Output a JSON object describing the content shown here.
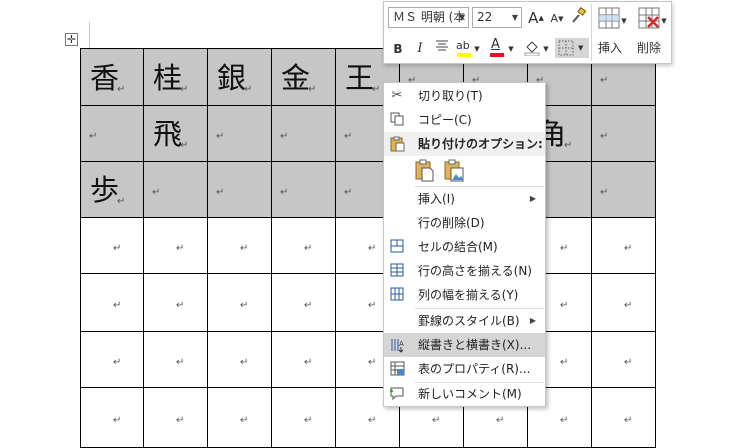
{
  "table": {
    "row_heights": [
      58,
      56,
      56,
      56,
      58,
      56,
      60
    ],
    "col_widths": [
      64,
      64,
      64,
      64,
      64,
      64,
      64,
      64,
      64
    ],
    "selected_rows": 3,
    "glyphs": {
      "0-0": "香",
      "0-1": "桂",
      "0-2": "銀",
      "0-3": "金",
      "0-4": "王",
      "1-1": "飛",
      "1-7": "角",
      "2-0": "歩"
    },
    "cell_end_mark": "↵"
  },
  "toolbar": {
    "font_name": "ＭＳ 明朝 (本",
    "font_size": "22",
    "bold": "B",
    "italic": "I",
    "insert_label": "挿入",
    "delete_label": "削除",
    "highlight_color": "#ffff00",
    "font_color": "#e81123"
  },
  "menu": {
    "cut": "切り取り(T)",
    "copy": "コピー(C)",
    "paste_options": "貼り付けのオプション:",
    "insert": "挿入(I)",
    "delete_rows": "行の削除(D)",
    "merge_cells": "セルの結合(M)",
    "distribute_rows": "行の高さを揃える(N)",
    "distribute_cols": "列の幅を揃える(Y)",
    "border_styles": "罫線のスタイル(B)",
    "text_direction": "縦書きと横書き(X)...",
    "table_properties": "表のプロパティ(R)...",
    "new_comment": "新しいコメント(M)"
  }
}
